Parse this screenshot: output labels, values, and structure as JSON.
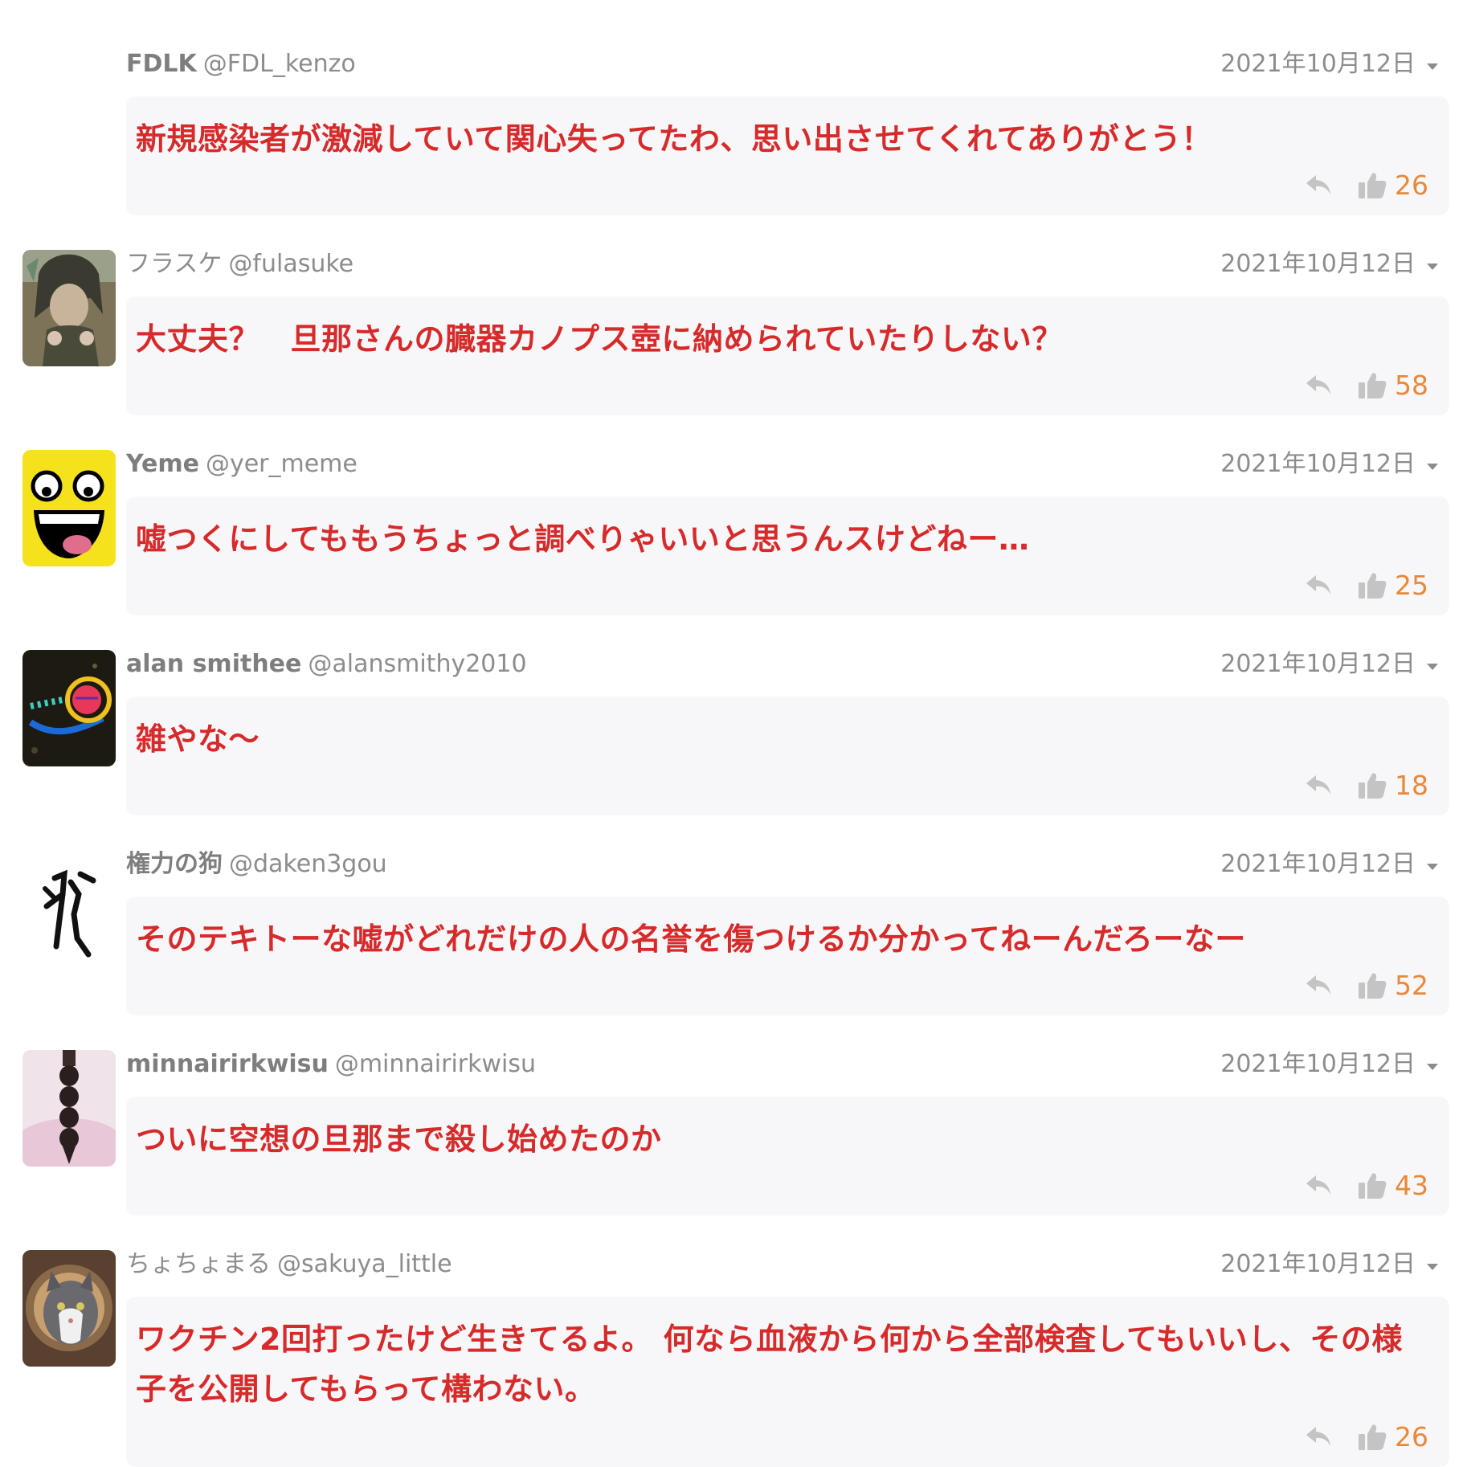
{
  "comments": [
    {
      "display_name": "FDLK",
      "handle": "@FDL_kenzo",
      "date": "2021年10月12日",
      "text": "新規感染者が激減していて関心失ってたわ、思い出させてくれてありがとう！",
      "likes": "26",
      "avatar": "none"
    },
    {
      "display_name": "フラスケ",
      "handle": "@fulasuke",
      "date": "2021年10月12日",
      "text": "大丈夫？　旦那さんの臓器カノプス壺に納められていたりしない？",
      "likes": "58",
      "avatar": "anime-character"
    },
    {
      "display_name": "Yeme",
      "handle": "@yer_meme",
      "date": "2021年10月12日",
      "text": "嘘つくにしてももうちょっと調べりゃいいと思うんスけどねー…",
      "likes": "25",
      "avatar": "smiley-face"
    },
    {
      "display_name": "alan smithee",
      "handle": "@alansmithy2010",
      "date": "2021年10月12日",
      "text": "雑やな〜",
      "likes": "18",
      "avatar": "neon-sign"
    },
    {
      "display_name": "権力の狗",
      "handle": "@daken3gou",
      "date": "2021年10月12日",
      "text": "そのテキトーな嘘がどれだけの人の名誉を傷つけるか分かってねーんだろーなー",
      "likes": "52",
      "avatar": "ancient-character"
    },
    {
      "display_name": "minnairirkwisu",
      "handle": "@minnairirkwisu",
      "date": "2021年10月12日",
      "text": "ついに空想の旦那まで殺し始めたのか",
      "likes": "43",
      "avatar": "braided-hair"
    },
    {
      "display_name": "ちょちょまる",
      "handle": "@sakuya_little",
      "date": "2021年10月12日",
      "text": "ワクチン2回打ったけど生きてるよ。 何なら血液から何から全部検査してもいいし、その様子を公開してもらって構わない。",
      "likes": "26",
      "avatar": "cat-photo"
    }
  ],
  "colors": {
    "comment_text": "#d72a2a",
    "like_count": "#e8893a",
    "meta": "#8c8c8c",
    "bubble": "#f7f7f9"
  },
  "icons": {
    "reply": "reply-arrow-icon",
    "like": "thumbs-up-icon",
    "menu": "caret-down-icon"
  }
}
